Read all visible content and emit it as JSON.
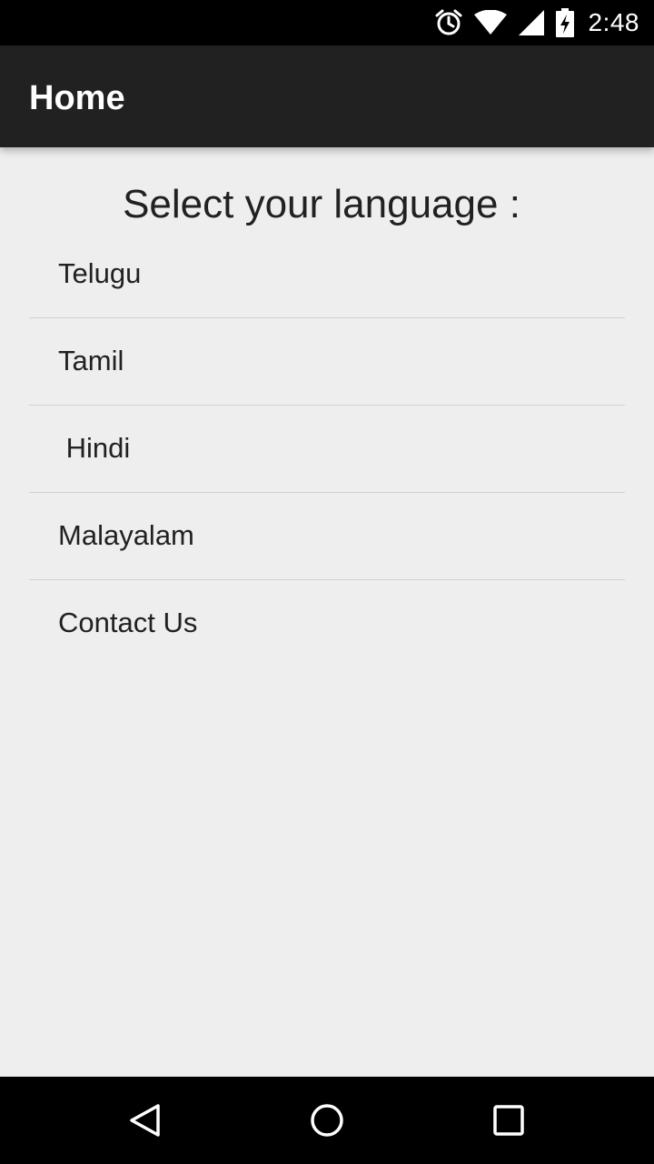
{
  "status_bar": {
    "time": "2:48",
    "icons": [
      "alarm-icon",
      "wifi-icon",
      "signal-icon",
      "battery-charging-icon"
    ]
  },
  "app_bar": {
    "title": "Home"
  },
  "main": {
    "heading": "Select your language :",
    "items": [
      {
        "label": "Telugu"
      },
      {
        "label": "Tamil"
      },
      {
        "label": " Hindi"
      },
      {
        "label": "Malayalam"
      },
      {
        "label": "Contact Us"
      }
    ]
  },
  "nav_bar": {
    "icons": [
      "back-icon",
      "home-icon",
      "recents-icon"
    ]
  },
  "colors": {
    "status_bar": "#000000",
    "app_bar": "#212121",
    "background": "#eeeeee",
    "text": "#212121",
    "divider": "#d0d0d0"
  }
}
